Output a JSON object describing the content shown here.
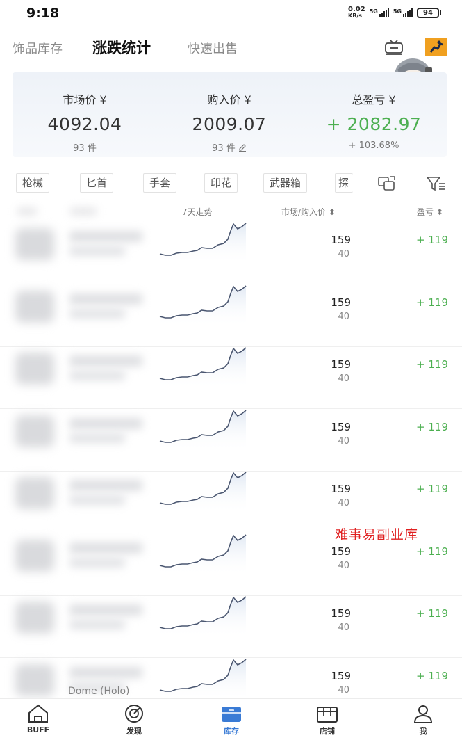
{
  "status_bar": {
    "time": "9:18",
    "net_speed_value": "0.02",
    "net_speed_unit": "KB/s",
    "signal1_label": "5G",
    "signal2_label": "5G",
    "battery": "94"
  },
  "top_tabs": {
    "items": [
      "饰品库存",
      "涨跌统计",
      "快速出售"
    ],
    "active_index": 1
  },
  "summary": {
    "market": {
      "label": "市场价 ¥",
      "value": "4092.04",
      "sub": "93 件"
    },
    "purchase": {
      "label": "购入价 ¥",
      "value": "2009.07",
      "sub": "93 件"
    },
    "profit": {
      "label": "总盈亏 ¥",
      "value": "+ 2082.97",
      "sub": "+ 103.68%"
    }
  },
  "categories": [
    "枪械",
    "匕首",
    "手套",
    "印花",
    "武器箱",
    "探"
  ],
  "list_header": {
    "trend": "7天走势",
    "price": "市场/购入价 ⬍",
    "profit": "盈亏 ⬍"
  },
  "rows": [
    {
      "market_price": "159",
      "buy_price": "40",
      "profit": "+ 119"
    },
    {
      "market_price": "159",
      "buy_price": "40",
      "profit": "+ 119"
    },
    {
      "market_price": "159",
      "buy_price": "40",
      "profit": "+ 119"
    },
    {
      "market_price": "159",
      "buy_price": "40",
      "profit": "+ 119"
    },
    {
      "market_price": "159",
      "buy_price": "40",
      "profit": "+ 119"
    },
    {
      "market_price": "159",
      "buy_price": "40",
      "profit": "+ 119"
    },
    {
      "market_price": "159",
      "buy_price": "40",
      "profit": "+ 119"
    },
    {
      "market_price": "159",
      "buy_price": "40",
      "profit": "+ 119"
    }
  ],
  "partial_item_name": "Dome (Holo)",
  "watermark": "难事易副业库",
  "bottom_nav": {
    "items": [
      "BUFF",
      "发现",
      "库存",
      "店铺",
      "我"
    ],
    "active_index": 2
  },
  "colors": {
    "profit_green": "#4caf50",
    "active_blue": "#3a7bd5",
    "watermark_red": "#e02020"
  }
}
